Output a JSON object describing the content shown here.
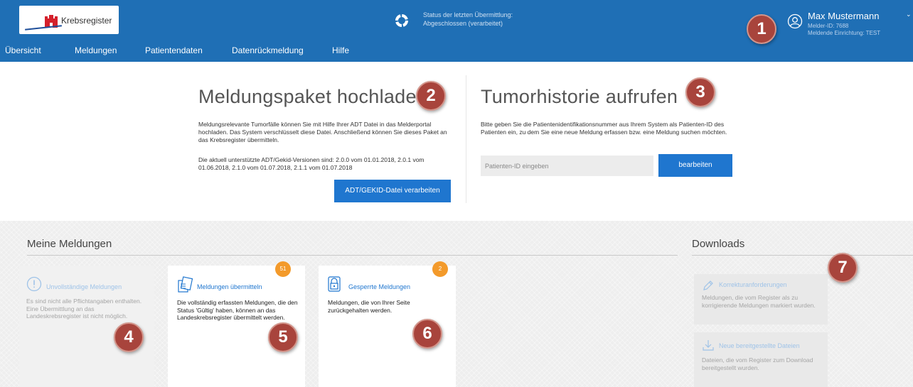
{
  "header": {
    "logo_text": "Krebsregister",
    "status_line1": "Status der letzten Übermittlung:",
    "status_line2": "Abgeschlossen (verarbeitet)",
    "user_name": "Max Mustermann",
    "melder_id": "Melder-ID: 7688",
    "einrichtung": "Meldende Einrichtung: TEST",
    "caret": "⌄"
  },
  "nav": [
    {
      "label": "Übersicht"
    },
    {
      "label": "Meldungen"
    },
    {
      "label": "Patientendaten"
    },
    {
      "label": "Datenrückmeldung"
    },
    {
      "label": "Hilfe"
    }
  ],
  "badges": [
    "1",
    "2",
    "3",
    "4",
    "5",
    "6",
    "7"
  ],
  "upload": {
    "title": "Meldungspaket hochladen",
    "para1": "Meldungsrelevante Tumorfälle können Sie mit Hilfe Ihrer ADT Datei in das Melderportal hochladen. Das System verschlüsselt diese Datei. Anschließend können Sie dieses Paket an das Krebsregister übermitteln.",
    "para2": "Die aktuell unterstützte ADT/Gekid-Versionen sind: 2.0.0 vom 01.01.2018, 2.0.1 vom 01.06.2018, 2.1.0 vom 01.07.2018, 2.1.1 vom 01.07.2018",
    "button": "ADT/GEKID-Datei verarbeiten"
  },
  "tumor": {
    "title": "Tumorhistorie aufrufen",
    "para": "Bitte geben Sie die Patientenidentifikationsnummer aus Ihrem System als Patienten-ID des Patienten ein, zu dem Sie eine neue Meldung erfassen bzw. eine Meldung suchen möchten.",
    "placeholder": "Patienten-ID eingeben",
    "button": "bearbeiten"
  },
  "meldungen": {
    "title": "Meine Meldungen",
    "cards": [
      {
        "title": "Unvollständige Meldungen",
        "text": "Es sind nicht alle Pflichtangaben enthalten. Eine Übermittlung an das Landeskrebsregister ist nicht möglich.",
        "icon": "exclamation-circle-icon"
      },
      {
        "title": "Meldungen übermitteln",
        "text": "Die vollständig erfassten Meldungen, die den Status 'Gültig' haben, können an das Landeskrebsregister übermittelt werden.",
        "count": "51",
        "icon": "documents-icon"
      },
      {
        "title": "Gesperrte Meldungen",
        "text": "Meldungen, die von Ihrer Seite zurückgehalten werden.",
        "count": "2",
        "icon": "lock-icon"
      }
    ]
  },
  "downloads": {
    "title": "Downloads",
    "cards": [
      {
        "title": "Korrekturanforderungen",
        "text": "Meldungen, die vom Register als zu korrigierende Meldungen markiert wurden.",
        "icon": "pencil-icon"
      },
      {
        "title": "Neue bereitgestellte Dateien",
        "text": "Dateien, die vom Register zum Download bereitgestellt wurden.",
        "icon": "download-icon"
      }
    ]
  },
  "colors": {
    "header": "#1f6fb5",
    "button": "#1f76cf",
    "badge": "#a8443c",
    "count": "#f39a2b"
  }
}
